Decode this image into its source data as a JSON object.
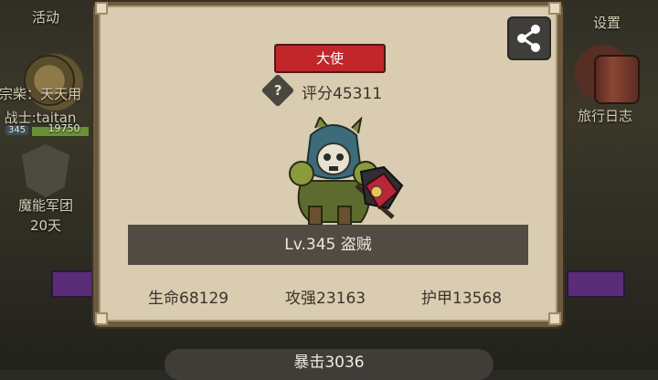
{
  "side_left": {
    "activity_label": "活动",
    "guild_line": "宗柴：天天用",
    "player_line": "战士:taitan",
    "level_badge": "345",
    "exp_text": "19750",
    "legion_label": "魔能军团",
    "legion_days": "20天"
  },
  "side_right": {
    "settings_label": "设置",
    "travel_log_label": "旅行日志"
  },
  "panel": {
    "title": "大使",
    "help_symbol": "?",
    "score": "评分45311",
    "level_class": "Lv.345 盗贼",
    "stats": [
      {
        "label": "生命68129"
      },
      {
        "label": "攻强23163"
      },
      {
        "label": "护甲13568"
      }
    ],
    "crit": "暴击3036"
  },
  "icons": {
    "share": "share-icon",
    "hero": "rogue-character-sprite"
  },
  "colors": {
    "title_badge": "#c0262a",
    "panel_bg": "#d9ccb0",
    "level_bar": "#524b42"
  }
}
